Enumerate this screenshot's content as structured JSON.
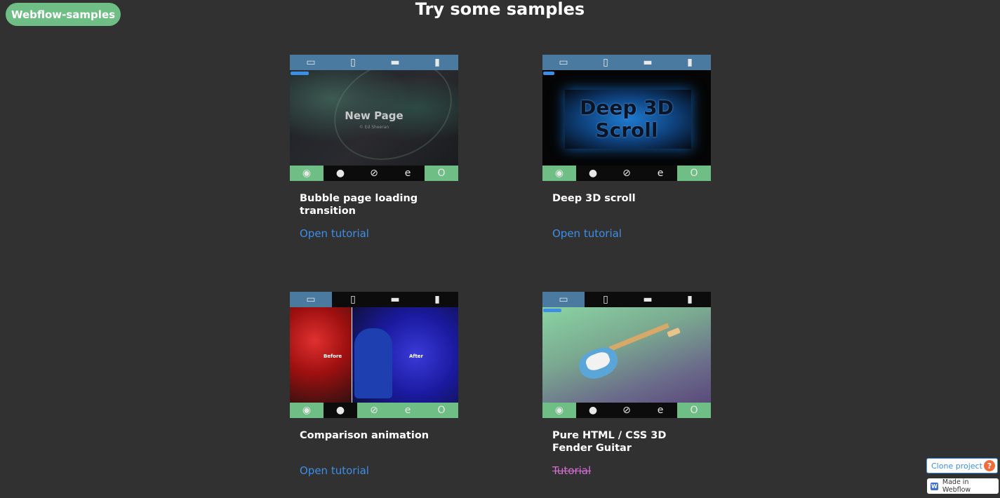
{
  "header": {
    "brand": "Webflow-samples",
    "title": "Try some samples"
  },
  "icons": {
    "devices": [
      "desktop-icon",
      "tablet-icon",
      "mobile-landscape-icon",
      "mobile-portrait-icon"
    ],
    "browsers": [
      "chrome-icon",
      "firefox-icon",
      "safari-icon",
      "ie-icon",
      "opera-icon"
    ],
    "opera_glyph": "O",
    "ie_glyph": "e"
  },
  "cards": [
    {
      "title": "Bubble page loading transition",
      "link": "Open tutorial",
      "preview_title": "New Page",
      "preview_subtitle": "© Ed Sheeran"
    },
    {
      "title": "Deep 3D scroll",
      "link": "Open tutorial",
      "preview_line1": "Deep 3D",
      "preview_line2": "Scroll"
    },
    {
      "title": "Comparison animation",
      "link": "Open tutorial",
      "before_label": "Before",
      "after_label": "After"
    },
    {
      "title": "Pure HTML / CSS 3D Fender Guitar",
      "link": "Tutorial"
    }
  ],
  "footer": {
    "clone_label": "Clone project",
    "help_glyph": "?",
    "badge_label": "Made in Webflow",
    "badge_glyph": "W"
  },
  "colors": {
    "background": "#313131",
    "accent_green": "#6fbe86",
    "link_blue": "#3d8ee6",
    "device_bar_blue": "#4a7aa0",
    "strike_pink": "#d46fd4"
  }
}
